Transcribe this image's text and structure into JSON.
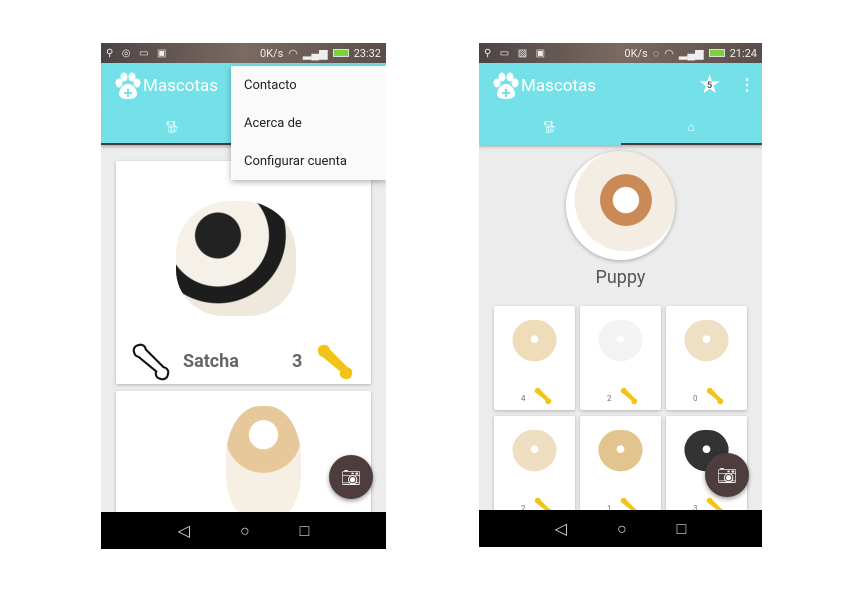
{
  "left_screen": {
    "status": {
      "speed": "0K/s",
      "time": "23:32"
    },
    "toolbar": {
      "title": "Mascotas",
      "icon": "paw-icon"
    },
    "tabs": [
      {
        "icon": "dog-icon"
      },
      {
        "icon": "home-icon"
      }
    ],
    "menu": {
      "items": [
        "Contacto",
        "Acerca de",
        "Configurar cuenta"
      ]
    },
    "cards": [
      {
        "name": "Satcha",
        "likes": "3"
      },
      {
        "name": "",
        "likes": ""
      }
    ],
    "fab_icon": "camera-icon"
  },
  "right_screen": {
    "status": {
      "speed": "0K/s",
      "time": "21:24"
    },
    "toolbar": {
      "title": "Mascotas",
      "star_badge": "5",
      "icon": "paw-icon"
    },
    "tabs": [
      {
        "icon": "dog-icon"
      },
      {
        "icon": "home-icon"
      }
    ],
    "active_tab": 1,
    "profile": {
      "name": "Puppy"
    },
    "grid": [
      {
        "likes": "4"
      },
      {
        "likes": "2"
      },
      {
        "likes": "0"
      },
      {
        "likes": "2"
      },
      {
        "likes": "1"
      },
      {
        "likes": "3"
      }
    ],
    "fab_icon": "camera-icon"
  },
  "colors": {
    "primary": "#74e0e8",
    "accent": "#4e3d3d",
    "bone": "#f2c417"
  }
}
